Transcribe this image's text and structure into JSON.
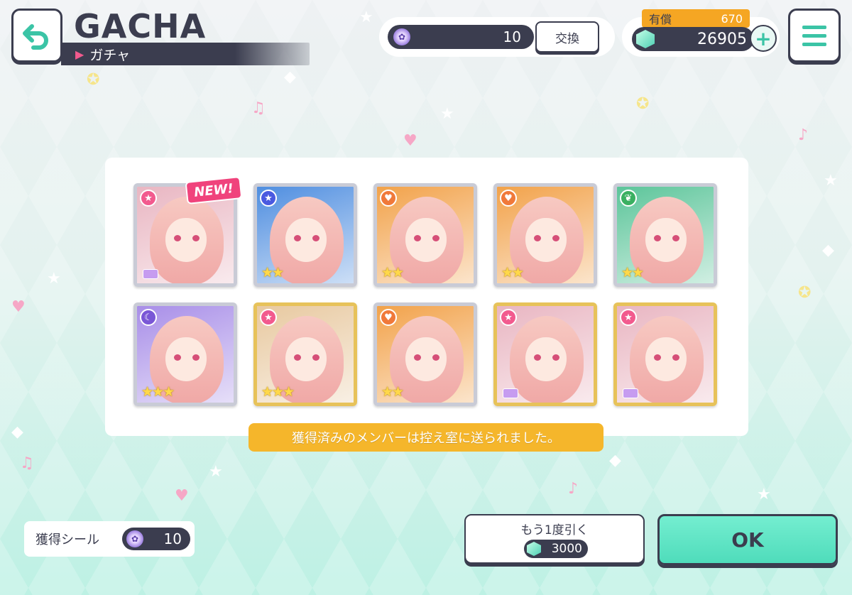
{
  "header": {
    "title": "GACHA",
    "subtitle": "ガチャ"
  },
  "currency": {
    "seal_count": "10",
    "exchange_label": "交換",
    "paid_label": "有償",
    "paid_value": "670",
    "star_count": "26905",
    "plus_label": "+"
  },
  "results": {
    "new_badge": "NEW!",
    "cards": [
      {
        "attribute": "happy",
        "icon": "star-icon",
        "rarity": 4,
        "frame": "silver",
        "bg": "#e9b6c2"
      },
      {
        "attribute": "cool",
        "icon": "star-icon",
        "rarity": 2,
        "frame": "silver",
        "bg": "#4f8ee0"
      },
      {
        "attribute": "powerful",
        "icon": "heart-icon",
        "rarity": 2,
        "frame": "silver",
        "bg": "#f2a24a"
      },
      {
        "attribute": "powerful",
        "icon": "heart-icon",
        "rarity": 2,
        "frame": "silver",
        "bg": "#f2a24a"
      },
      {
        "attribute": "pure",
        "icon": "sprout-icon",
        "rarity": 2,
        "frame": "silver",
        "bg": "#5cc59a"
      },
      {
        "attribute": "moon",
        "icon": "moon-icon",
        "rarity": 3,
        "frame": "silver",
        "bg": "#a88ee8"
      },
      {
        "attribute": "happy",
        "icon": "star-icon",
        "rarity": 3,
        "frame": "gold",
        "bg": "#e8c9a0"
      },
      {
        "attribute": "powerful",
        "icon": "heart-icon",
        "rarity": 2,
        "frame": "silver",
        "bg": "#f2a24a"
      },
      {
        "attribute": "happy",
        "icon": "star-icon",
        "rarity": 4,
        "frame": "gold",
        "bg": "#e9b6c2"
      },
      {
        "attribute": "happy",
        "icon": "star-icon",
        "rarity": 4,
        "frame": "gold",
        "bg": "#e9b6c2"
      }
    ],
    "notice": "獲得済みのメンバーは控え室に送られました。"
  },
  "footer": {
    "obtained_label": "獲得シール",
    "obtained_count": "10",
    "again_label": "もう1度引く",
    "again_cost": "3000",
    "ok_label": "OK"
  },
  "colors": {
    "accent": "#3bc4a6",
    "dark": "#3b3d4f",
    "notice": "#f5b62b",
    "new": "#f0437c"
  }
}
